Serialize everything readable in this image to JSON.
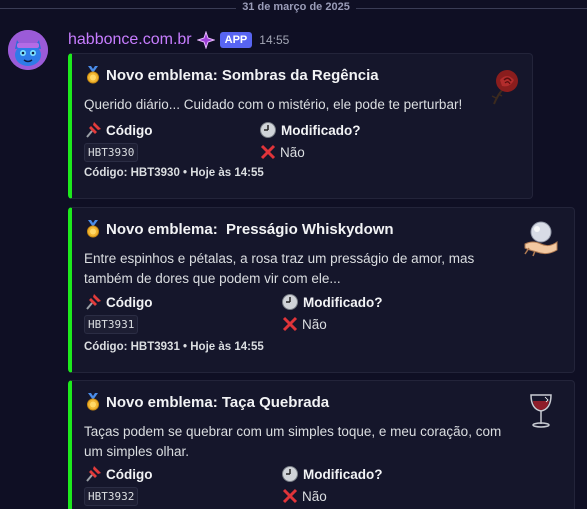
{
  "date_divider": "31 de março de 2025",
  "message": {
    "username": "habbonce.com.br",
    "app_badge": "APP",
    "timestamp": "14:55"
  },
  "embeds": [
    {
      "title": "Novo emblema: Sombras da Regência",
      "description": "Querido diário... Cuidado com o mistério, ele pode te perturbar!",
      "code_label": "Código",
      "code_value": "HBT3930",
      "modified_label": "Modificado?",
      "modified_value": "Não",
      "footer": "Código: HBT3930 • Hoje às 14:55",
      "thumbnail": "rose-icon"
    },
    {
      "title": "Novo emblema:  Presságio Whiskydown",
      "description": "Entre espinhos e pétalas, a rosa traz um presságio de amor, mas também de dores que podem vir com ele...",
      "code_label": "Código",
      "code_value": "HBT3931",
      "modified_label": "Modificado?",
      "modified_value": "Não",
      "footer": "Código: HBT3931 • Hoje às 14:55",
      "thumbnail": "crystal-ball-hand-icon"
    },
    {
      "title": "Novo emblema: Taça Quebrada",
      "description": "Taças podem se quebrar com um simples toque, e meu coração, com um simples olhar.",
      "code_label": "Código",
      "code_value": "HBT3932",
      "modified_label": "Modificado?",
      "modified_value": "Não",
      "footer": "",
      "thumbnail": "wine-glass-icon"
    }
  ],
  "colors": {
    "accent": "#1de91d",
    "username": "#c77dff",
    "badge": "#5865f2",
    "background": "#0f0f24"
  }
}
